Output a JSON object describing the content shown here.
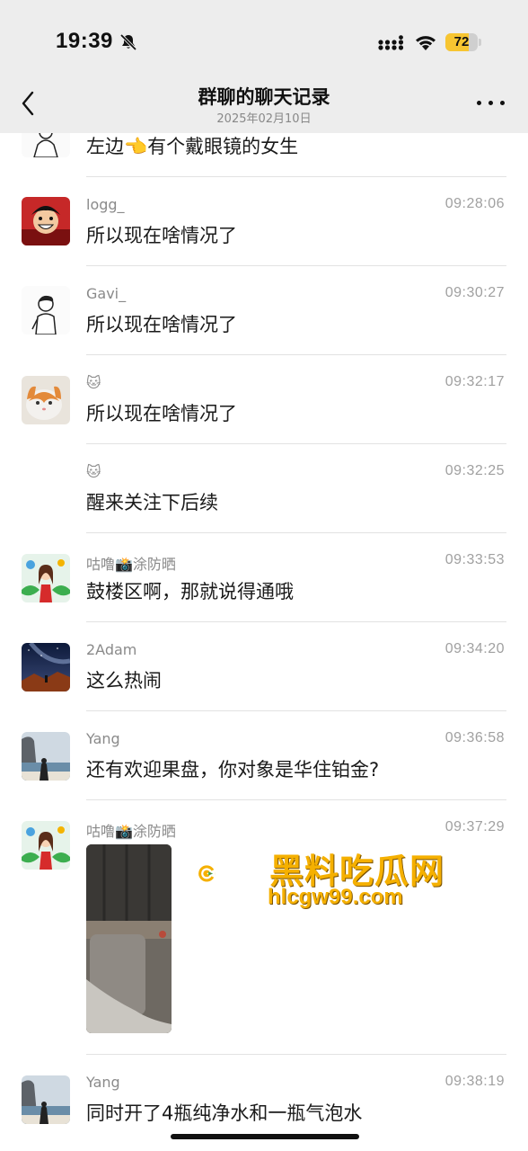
{
  "status_bar": {
    "time": "19:39",
    "battery": "72",
    "battery_level": 0.72,
    "battery_color": "#f7c531"
  },
  "header": {
    "title": "群聊的聊天记录",
    "subtitle": "2025年02月10日",
    "back_icon": "chevron-left-icon",
    "more_icon": "ellipsis-icon"
  },
  "messages": [
    {
      "sender": "",
      "time": "",
      "text": "左边👈有个戴眼镜的女生"
    },
    {
      "sender": "logg_",
      "time": "09:28:06",
      "text": "所以现在啥情况了"
    },
    {
      "sender": "Gavi_",
      "time": "09:30:27",
      "text": "所以现在啥情况了"
    },
    {
      "sender": "🐱",
      "time": "09:32:17",
      "text": "所以现在啥情况了"
    },
    {
      "sender": "🐱",
      "time": "09:32:25",
      "text": "醒来关注下后续"
    },
    {
      "sender": "咕噜📸涂防晒",
      "time": "09:33:53",
      "text": "鼓楼区啊，那就说得通哦"
    },
    {
      "sender": "2Adam",
      "time": "09:34:20",
      "text": "这么热闹"
    },
    {
      "sender": "Yang",
      "time": "09:36:58",
      "text": "还有欢迎果盘，你对象是华住铂金?"
    },
    {
      "sender": "咕噜📸涂防晒",
      "time": "09:37:29",
      "text": ""
    },
    {
      "sender": "Yang",
      "time": "09:38:19",
      "text": "同时开了4瓶纯净水和一瓶气泡水"
    }
  ],
  "watermark": {
    "title": "黑料吃瓜网",
    "url": "hlcgw99.com",
    "color": "#f5b000"
  }
}
